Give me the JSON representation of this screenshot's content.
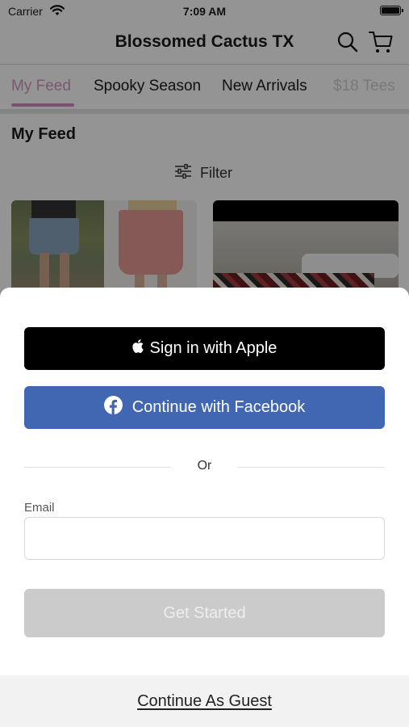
{
  "status_bar": {
    "carrier": "Carrier",
    "time": "7:09 AM"
  },
  "header": {
    "title": "Blossomed Cactus TX"
  },
  "tabs": [
    {
      "label": "My Feed",
      "active": true
    },
    {
      "label": "Spooky Season",
      "active": false
    },
    {
      "label": "New Arrivals",
      "active": false
    },
    {
      "label": "$18 Tees",
      "active": false
    }
  ],
  "feed": {
    "title": "My Feed",
    "filter_label": "Filter"
  },
  "colors": {
    "accent": "#d497c5",
    "facebook": "#4267b2",
    "apple": "#000000",
    "disabled_button": "#cbcbcb"
  },
  "sheet": {
    "apple_label": "Sign in with Apple",
    "facebook_label": "Continue with Facebook",
    "or_label": "Or",
    "email_label": "Email",
    "email_value": "",
    "get_started_label": "Get Started",
    "guest_label": "Continue As Guest"
  }
}
